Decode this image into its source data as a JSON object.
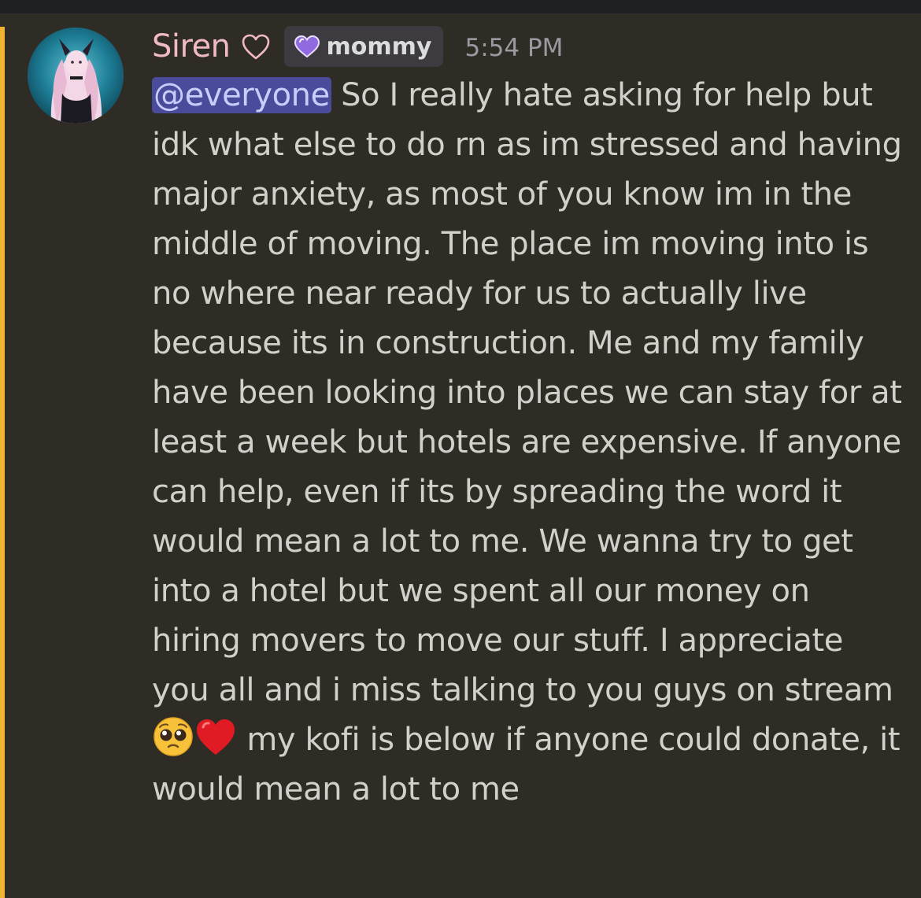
{
  "message": {
    "author": {
      "username": "Siren",
      "name_icon": "heart-outline-icon",
      "role_icon": "purple-heart-icon",
      "role_label": "mommy",
      "username_color": "#f0b9c6"
    },
    "timestamp": "5:54 PM",
    "mention": "@everyone",
    "text_part1": " So I really hate asking for help but idk what else to do rn as im stressed and having major anxiety, as most of you know im in the middle of moving. The place im moving into is no where near ready for us to actually live because its in construction. Me and my family have been looking into places we can stay for at least a week but hotels are expensive. If anyone can help, even if its by spreading the word it would mean a lot to me. We wanna try to get into a hotel but we spent all our money on hiring movers to move our stuff. I appreciate you all and i miss talking to you guys on stream ",
    "emoji_1": "pleading-face-emoji",
    "emoji_2": "red-heart-emoji",
    "text_part2": " my kofi is below if anyone could donate, it would mean a lot to me",
    "mention_highlight_color": "#f0b232"
  }
}
